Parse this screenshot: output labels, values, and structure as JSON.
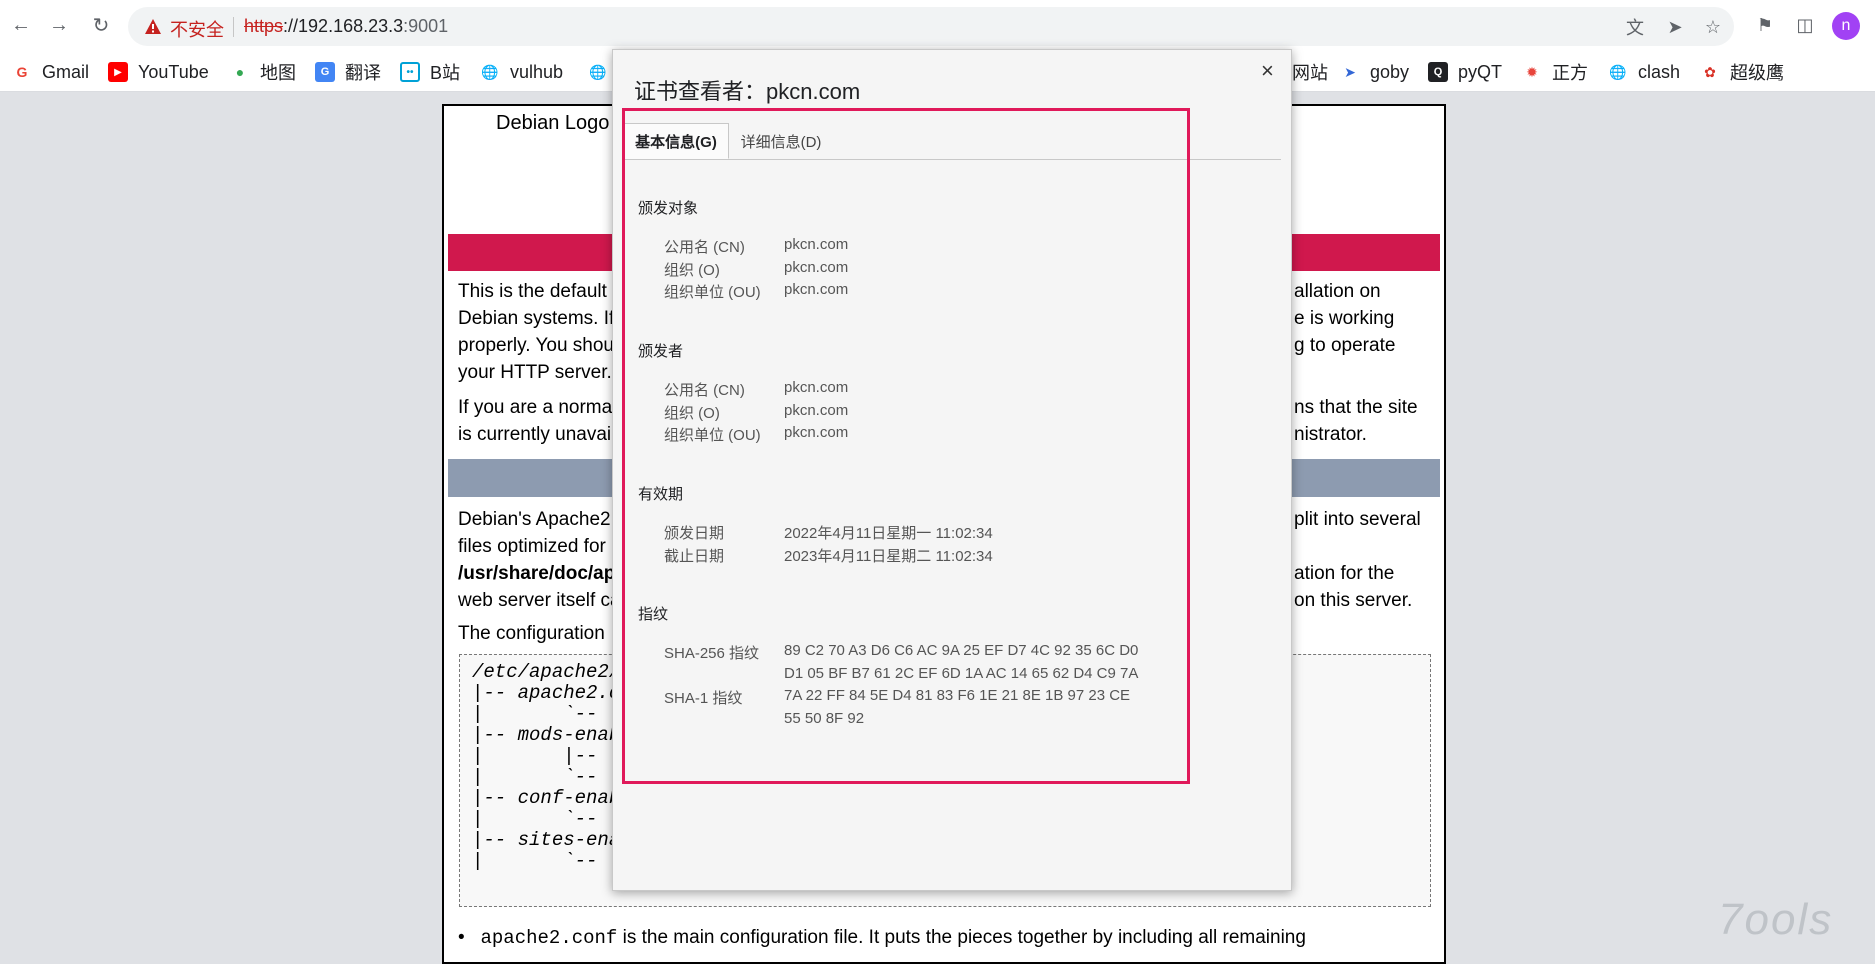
{
  "browser": {
    "insecure_label": "不安全",
    "url_scheme": "https",
    "url_host": "://192.168.23.3",
    "url_port": ":9001",
    "avatar_letter": "n",
    "icons": [
      "back-arrow-icon",
      "forward-arrow-icon",
      "reload-icon",
      "warning-icon",
      "translate-icon",
      "send-icon",
      "star-icon",
      "extensions-icon",
      "side-panel-icon"
    ]
  },
  "bookmarks": [
    {
      "label": "Gmail",
      "icon": "gmail-icon",
      "color": "#ea4335"
    },
    {
      "label": "YouTube",
      "icon": "youtube-icon",
      "color": "#ff0000"
    },
    {
      "label": "地图",
      "icon": "maps-icon",
      "color": "#34a853"
    },
    {
      "label": "翻译",
      "icon": "translate-icon",
      "color": "#4285f4"
    },
    {
      "label": "B站",
      "icon": "bilibili-icon",
      "color": "#00a1d6"
    },
    {
      "label": "vulhub",
      "icon": "globe-icon",
      "color": "#5f6368"
    },
    {
      "label": "网站",
      "icon": "globe-icon",
      "color": "#5f6368"
    },
    {
      "label": "goby",
      "icon": "goby-icon",
      "color": "#3367d6"
    },
    {
      "label": "pyQT",
      "icon": "pyqt-icon",
      "color": "#202124"
    },
    {
      "label": "正方",
      "icon": "zhengfang-icon",
      "color": "#e8453c"
    },
    {
      "label": "clash",
      "icon": "globe-icon",
      "color": "#5f6368"
    },
    {
      "label": "超级鹰",
      "icon": "eagle-icon",
      "color": "#d93025"
    }
  ],
  "background_page": {
    "logo_alt": "Debian Logo",
    "para1": [
      "This is the default",
      "Debian systems. If",
      "properly. You shou",
      "your HTTP server."
    ],
    "para1_right": [
      "allation on",
      "e is working",
      "g to operate"
    ],
    "para2": [
      "If you are a norma",
      "is currently unavai"
    ],
    "para2_right": [
      "ns that the site",
      "nistrator."
    ],
    "para3": [
      "Debian's Apache2",
      "files optimized for",
      "/usr/share/doc/ap",
      "web server itself ca"
    ],
    "para3_right": [
      "plit into several",
      "ation for the",
      "on this server."
    ],
    "config_intro": "The configuration",
    "code_lines": [
      "/etc/apache2/",
      "|-- apache2.c",
      "|       `--",
      "|-- mods-enab",
      "|       |-- *",
      "|       `-- *",
      "|-- conf-enab",
      "|       `-- *",
      "|-- sites-ena",
      "|       `-- *"
    ],
    "bullet_code": "apache2.conf",
    "bullet_text": " is the main configuration file. It puts the pieces together by including all remaining"
  },
  "dialog": {
    "title": "证书查看者：pkcn.com",
    "close": "×",
    "tabs": [
      {
        "label": "基本信息(G)",
        "active": true
      },
      {
        "label": "详细信息(D)",
        "active": false
      }
    ],
    "issued_to": {
      "title": "颁发对象",
      "rows": [
        {
          "label": "公用名 (CN)",
          "value": "pkcn.com"
        },
        {
          "label": "组织 (O)",
          "value": "pkcn.com"
        },
        {
          "label": "组织单位 (OU)",
          "value": "pkcn.com"
        }
      ]
    },
    "issued_by": {
      "title": "颁发者",
      "rows": [
        {
          "label": "公用名 (CN)",
          "value": "pkcn.com"
        },
        {
          "label": "组织 (O)",
          "value": "pkcn.com"
        },
        {
          "label": "组织单位 (OU)",
          "value": "pkcn.com"
        }
      ]
    },
    "validity": {
      "title": "有效期",
      "rows": [
        {
          "label": "颁发日期",
          "value": "2022年4月11日星期一 11:02:34"
        },
        {
          "label": "截止日期",
          "value": "2023年4月11日星期二 11:02:34"
        }
      ]
    },
    "fingerprints": {
      "title": "指纹",
      "sha256_label": "SHA-256 指纹",
      "sha256_line1": "89 C2 70 A3 D6 C6 AC 9A 25 EF D7 4C 92 35 6C D0",
      "sha256_line2": "D1 05 BF B7 61 2C EF 6D 1A AC 14 65 62 D4 C9 7A",
      "sha1_label": "SHA-1 指纹",
      "sha1_line1": "7A 22 FF 84 5E D4 81 83 F6 1E 21 8E 1B 97 23 CE",
      "sha1_line2": "55 50 8F 92"
    }
  },
  "watermark": "7ools",
  "colors": {
    "highlight": "#e0195a",
    "debian_red": "#d0184d",
    "insecure": "#c5221f"
  }
}
